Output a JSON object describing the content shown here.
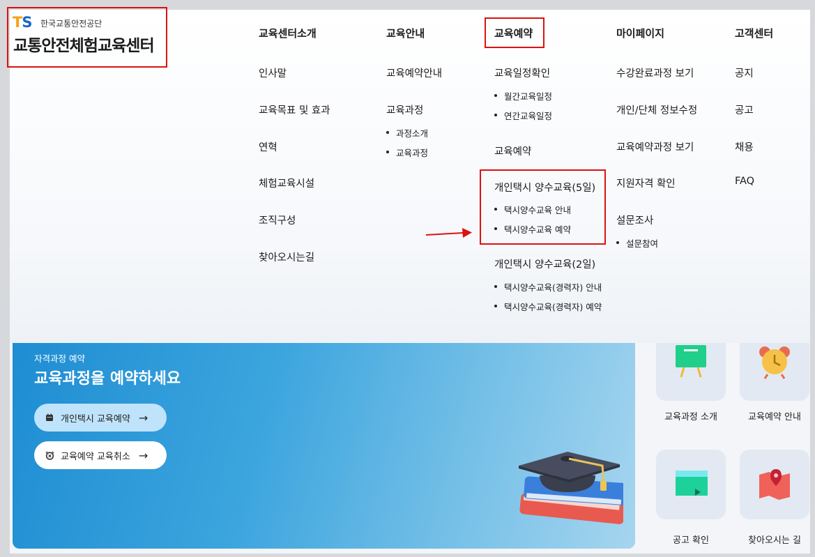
{
  "logo": {
    "ts_t": "T",
    "ts_s": "S",
    "org_name": "한국교통안전공단",
    "center_name": "교통안전체험교육센터"
  },
  "menu": {
    "about": {
      "heading": "교육센터소개",
      "items": [
        "인사말",
        "교육목표 및 효과",
        "연혁",
        "체험교육시설",
        "조직구성",
        "찾아오시는길"
      ]
    },
    "guide": {
      "heading": "교육안내",
      "items": [
        "교육예약안내",
        "교육과정"
      ],
      "sub": [
        "과정소개",
        "교육과정"
      ]
    },
    "reserve": {
      "heading": "교육예약",
      "schedule": "교육일정확인",
      "schedule_sub": [
        "월간교육일정",
        "연간교육일정"
      ],
      "reserve_item": "교육예약",
      "taxi5": "개인택시 양수교육(5일)",
      "taxi5_sub": [
        "택시양수교육 안내",
        "택시양수교육 예약"
      ],
      "taxi2": "개인택시 양수교육(2일)",
      "taxi2_sub": [
        "택시양수교육(경력자) 안내",
        "택시양수교육(경력자) 예약"
      ]
    },
    "mypage": {
      "heading": "마이페이지",
      "items": [
        "수강완료과정 보기",
        "개인/단체 정보수정",
        "교육예약과정 보기",
        "지원자격 확인",
        "설문조사"
      ],
      "sub": [
        "설문참여"
      ]
    },
    "support": {
      "heading": "고객센터",
      "items": [
        "공지",
        "공고",
        "채용",
        "FAQ"
      ]
    }
  },
  "hero": {
    "kicker": "자격과정 예약",
    "title": "교육과정을 예약하세요",
    "btn1": "개인택시 교육예약",
    "btn2": "교육예약 교육취소",
    "arrow": "→"
  },
  "tiles": [
    "교육과정 소개",
    "교육예약 안내",
    "공고 확인",
    "찾아오시는 길"
  ],
  "colors": {
    "highlight": "#dd1111",
    "hero_start": "#1e8dd2",
    "hero_end": "#a6d5ef",
    "logo_orange": "#f3a21b",
    "logo_blue": "#1a67c8"
  }
}
